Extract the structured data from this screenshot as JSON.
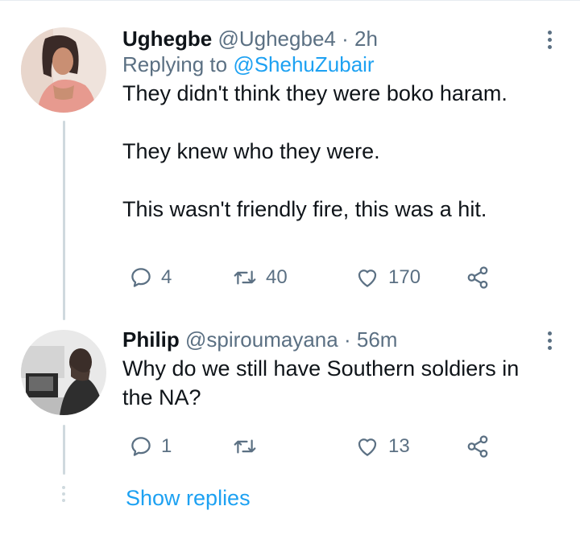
{
  "tweets": [
    {
      "display_name": "Ughegbe",
      "handle": "@Ughegbe4",
      "separator": "·",
      "time": "2h",
      "replying_prefix": "Replying to",
      "replying_to": "@ShehuZubair",
      "text": "They didn't think they were boko haram.\n\nThey knew who they were.\n\nThis wasn't friendly fire, this was a hit.",
      "reply_count": "4",
      "retweet_count": "40",
      "like_count": "170"
    },
    {
      "display_name": "Philip",
      "handle": "@spiroumayana",
      "separator": "·",
      "time": "56m",
      "text": "Why do we still have Southern soldiers in\nthe NA?",
      "reply_count": "1",
      "retweet_count": "",
      "like_count": "13"
    }
  ],
  "show_replies_label": "Show replies",
  "colors": {
    "link": "#1da1f2",
    "muted": "#5b7083",
    "thread": "#cfd9de"
  },
  "icons": [
    "reply-icon",
    "retweet-icon",
    "like-icon",
    "share-icon",
    "more-options-icon"
  ]
}
